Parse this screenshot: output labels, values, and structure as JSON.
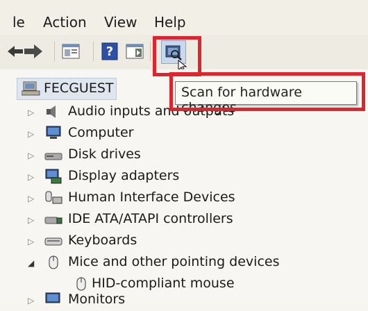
{
  "menu": {
    "file_partial": "le",
    "action": "Action",
    "view": "View",
    "help": "Help"
  },
  "toolbar": {
    "tooltip": "Scan for hardware changes",
    "icons": [
      "forward-arrow-icon",
      "properties-icon",
      "help-icon",
      "view-pane-icon",
      "scan-hardware-icon"
    ]
  },
  "tree": {
    "root": "FECGUEST",
    "items": [
      {
        "label": "Audio inputs and outputs",
        "icon": "speaker-icon",
        "expanded": false
      },
      {
        "label": "Computer",
        "icon": "computer-icon",
        "expanded": false
      },
      {
        "label": "Disk drives",
        "icon": "disk-drive-icon",
        "expanded": false
      },
      {
        "label": "Display adapters",
        "icon": "display-adapter-icon",
        "expanded": false
      },
      {
        "label": "Human Interface Devices",
        "icon": "hid-icon",
        "expanded": false
      },
      {
        "label": "IDE ATA/ATAPI controllers",
        "icon": "ide-controller-icon",
        "expanded": false
      },
      {
        "label": "Keyboards",
        "icon": "keyboard-icon",
        "expanded": false
      },
      {
        "label": "Mice and other pointing devices",
        "icon": "mouse-icon",
        "expanded": true
      },
      {
        "label": "HID-compliant mouse",
        "icon": "mouse-icon",
        "child": true
      },
      {
        "label": "Monitors",
        "icon": "monitor-icon",
        "expanded": false
      }
    ]
  },
  "colors": {
    "highlight": "#e0242e",
    "selection": "#dfe6f0"
  }
}
